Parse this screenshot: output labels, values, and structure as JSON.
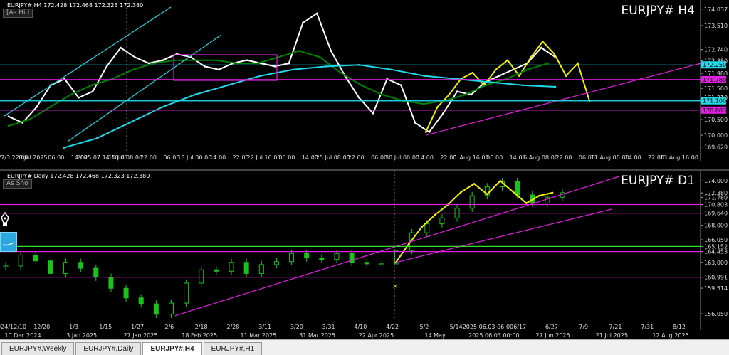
{
  "colors": {
    "background": "#000000",
    "grid": "#8a8a8a",
    "white": "#ffffff",
    "yellow": "#f0f000",
    "green_fast": "#2ee02e",
    "green_slow": "#26b026",
    "cyan": "#21d8e8",
    "magenta": "#e020e0",
    "candle": "#19c419"
  },
  "tabs": [
    {
      "label": "EURJPY#,Weekly",
      "active": false
    },
    {
      "label": "EURJPY#,Daily",
      "active": false
    },
    {
      "label": "EURJPY#,H4",
      "active": true
    },
    {
      "label": "EURJPY#,H1",
      "active": false
    }
  ],
  "h4": {
    "header": "EURJPY#,H4  172.428 172.468 172.323 172.380",
    "button": "[As Hid",
    "symbol": "EURJPY# H4",
    "price_ticks": [
      "174.037",
      "173.510",
      "172.740",
      "172.380",
      "171.980",
      "171.500",
      "171.210",
      "170.500",
      "170.000",
      "169.620"
    ],
    "price_labels": [
      {
        "text": "172.250",
        "bg": "#21d8e8",
        "fg": "#000000"
      },
      {
        "text": "171.780",
        "bg": "#e020e0",
        "fg": "#000000"
      },
      {
        "text": "171.100",
        "bg": "#21d8e8",
        "fg": "#000000"
      },
      {
        "text": "170.803",
        "bg": "#e020e0",
        "fg": "#000000"
      }
    ],
    "time_ticks": [
      "25/7/3 22:00",
      "8 Jul 2025",
      "06:00",
      "14:00",
      "2025.07.14 10:00",
      "15 Jul 08:00",
      "22:00",
      "06:00",
      "18 Jul 00:00",
      "14:00",
      "22:00",
      "22 Jul 16:00",
      "06:00",
      "14:00",
      "25 Jul 08:00",
      "22:00",
      "06:00",
      "30 Jul 00:00",
      "14:00",
      "22:00",
      "1 Aug 16:00",
      "06:00",
      "14:00",
      "6 Aug 08:00",
      "22:00",
      "06:00",
      "11 Aug 00:00",
      "14:00",
      "22:00",
      "13 Aug 16:00"
    ]
  },
  "d1": {
    "header": "EURJPY#,Daily  172.428 172.468 172.323 172.380",
    "button": "As Sho",
    "symbol": "EURJPY# D1",
    "price_ticks": [
      "174.000",
      "172.380",
      "171.780",
      "170.803",
      "169.640",
      "168.000",
      "166.050",
      "165.152",
      "164.453",
      "163.000",
      "160.991",
      "159.514",
      "156.050"
    ],
    "time_ticks": [
      "2024/12/10",
      "12/20",
      "1/3",
      "1/15",
      "1/27",
      "2/6",
      "2/18",
      "2/28",
      "3/11",
      "3/20",
      "3/31",
      "4/10",
      "4/22",
      "5/2",
      "5/14",
      "2025.06.03 06:00",
      "6/17",
      "6/27",
      "7/9",
      "7/21",
      "7/31",
      "8/12"
    ],
    "date_ticks": [
      "10 Dec 2024",
      "3 Jan 2025",
      "27 Jan 2025",
      "18 Feb 2025",
      "11 Mar 2025",
      "31 Mar 2025",
      "22 Apr 2025",
      "14 May",
      "2025.06.03 00:00",
      "27 Jun 2025",
      "21 Jul 2025",
      "12 Aug 2025"
    ]
  },
  "chart_data": [
    {
      "type": "line",
      "title": "EURJPY# H4",
      "ylim": [
        169.5,
        174.1
      ],
      "series": [
        {
          "name": "",
          "color": "white",
          "values": [
            170.6,
            170.4,
            170.9,
            171.6,
            171.8,
            171.2,
            171.4,
            172.2,
            172.8,
            172.5,
            172.3,
            172.4,
            172.6,
            172.5,
            172.2,
            172.1,
            172.3,
            172.4,
            172.3,
            172.2,
            172.3,
            173.6,
            173.9,
            172.7,
            171.9,
            171.2,
            170.7,
            171.8,
            171.6,
            170.4,
            170.1,
            170.7,
            171.4,
            171.3,
            171.7,
            171.9,
            172.1,
            172.3,
            172.8,
            172.5
          ]
        },
        {
          "name": "",
          "color": "yellow",
          "values": [
            170.1,
            170.9,
            171.3,
            171.8,
            172.0,
            171.6,
            172.1,
            172.4,
            171.9,
            172.5,
            173.0,
            172.6,
            171.9,
            172.3,
            171.1
          ]
        },
        {
          "name": "",
          "color": "green",
          "values": [
            170.3,
            170.5,
            170.9,
            171.3,
            171.6,
            171.8,
            172.1,
            172.3,
            172.4,
            172.4,
            172.4,
            172.3,
            172.3,
            172.5,
            172.7,
            172.5,
            172.0,
            171.6,
            171.3,
            171.1,
            171.0,
            171.1,
            171.3,
            171.6,
            171.8,
            172.1,
            172.3
          ]
        },
        {
          "name": "",
          "color": "cyan",
          "values": [
            169.6,
            169.9,
            170.4,
            170.9,
            171.3,
            171.6,
            171.9,
            172.1,
            172.2,
            172.25,
            172.1,
            171.9,
            171.8,
            171.7,
            171.6,
            171.55
          ]
        }
      ]
    },
    {
      "type": "line",
      "title": "EURJPY# D1",
      "ylim": [
        155.2,
        174.6
      ],
      "series": [
        {
          "name": "",
          "color": "candle",
          "values": [
            162.5,
            164.0,
            163.2,
            161.5,
            163.0,
            162.2,
            161.0,
            159.5,
            158.2,
            157.4,
            156.0,
            157.5,
            160.2,
            162.0,
            161.8,
            163.0,
            161.5,
            162.7,
            163.1,
            164.2,
            163.6,
            163.4,
            164.2,
            163.0,
            162.8,
            162.8,
            164.6,
            167.0,
            168.2,
            169.0,
            170.3,
            172.0,
            173.2,
            173.9,
            172.1,
            171.0,
            171.8,
            172.4
          ]
        },
        {
          "name": "",
          "color": "yellow",
          "values": [
            163.0,
            165.5,
            167.8,
            169.4,
            170.8,
            172.5,
            173.6,
            172.2,
            174.0,
            172.5,
            171.0,
            172.0,
            172.4
          ]
        }
      ]
    }
  ]
}
